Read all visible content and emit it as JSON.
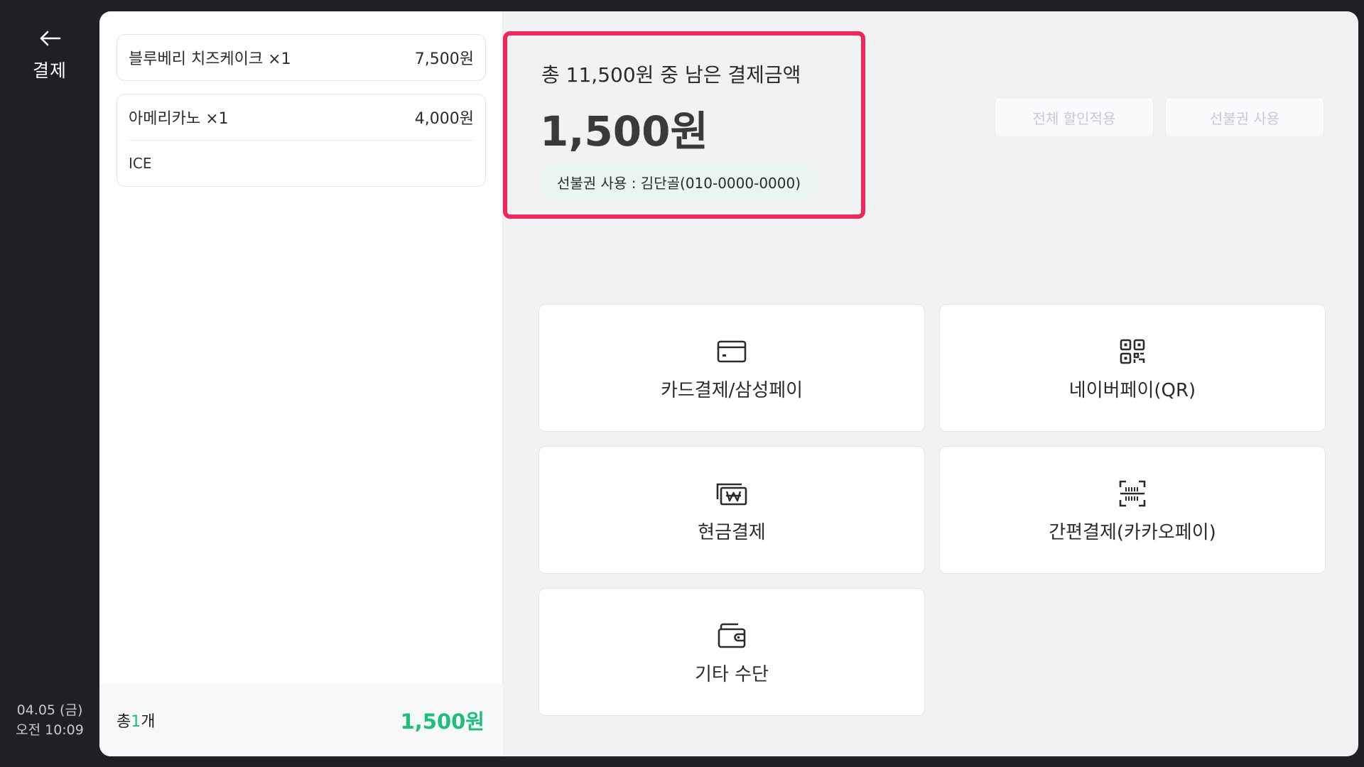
{
  "nav": {
    "back_label": "결제"
  },
  "datetime": {
    "date": "04.05 (금)",
    "time": "오전 10:09"
  },
  "orders": [
    {
      "name": "블루베리 치즈케이크 ×1",
      "price": "7,500원"
    },
    {
      "name": "아메리카노 ×1",
      "price": "4,000원",
      "option": "ICE"
    }
  ],
  "summary": {
    "prefix": "총",
    "count": "1",
    "suffix": "개",
    "total": "1,500원"
  },
  "remaining": {
    "title": "총 11,500원 중 남은 결제금액",
    "amount": "1,500원",
    "voucher": "선불권 사용 : 김단골(010-0000-0000)"
  },
  "actions": {
    "discount_label": "전체 할인적용",
    "voucher_label": "선불권 사용"
  },
  "payment_methods": [
    {
      "label": "카드결제/삼성페이",
      "icon": "card-icon"
    },
    {
      "label": "네이버페이(QR)",
      "icon": "qr-icon"
    },
    {
      "label": "현금결제",
      "icon": "cash-icon"
    },
    {
      "label": "간편결제(카카오페이)",
      "icon": "barcode-scan-icon"
    },
    {
      "label": "기타 수단",
      "icon": "wallet-icon"
    }
  ],
  "colors": {
    "accent_green": "#1fbf7a",
    "highlight_red": "#f0265c",
    "rail": "#1f2023"
  }
}
